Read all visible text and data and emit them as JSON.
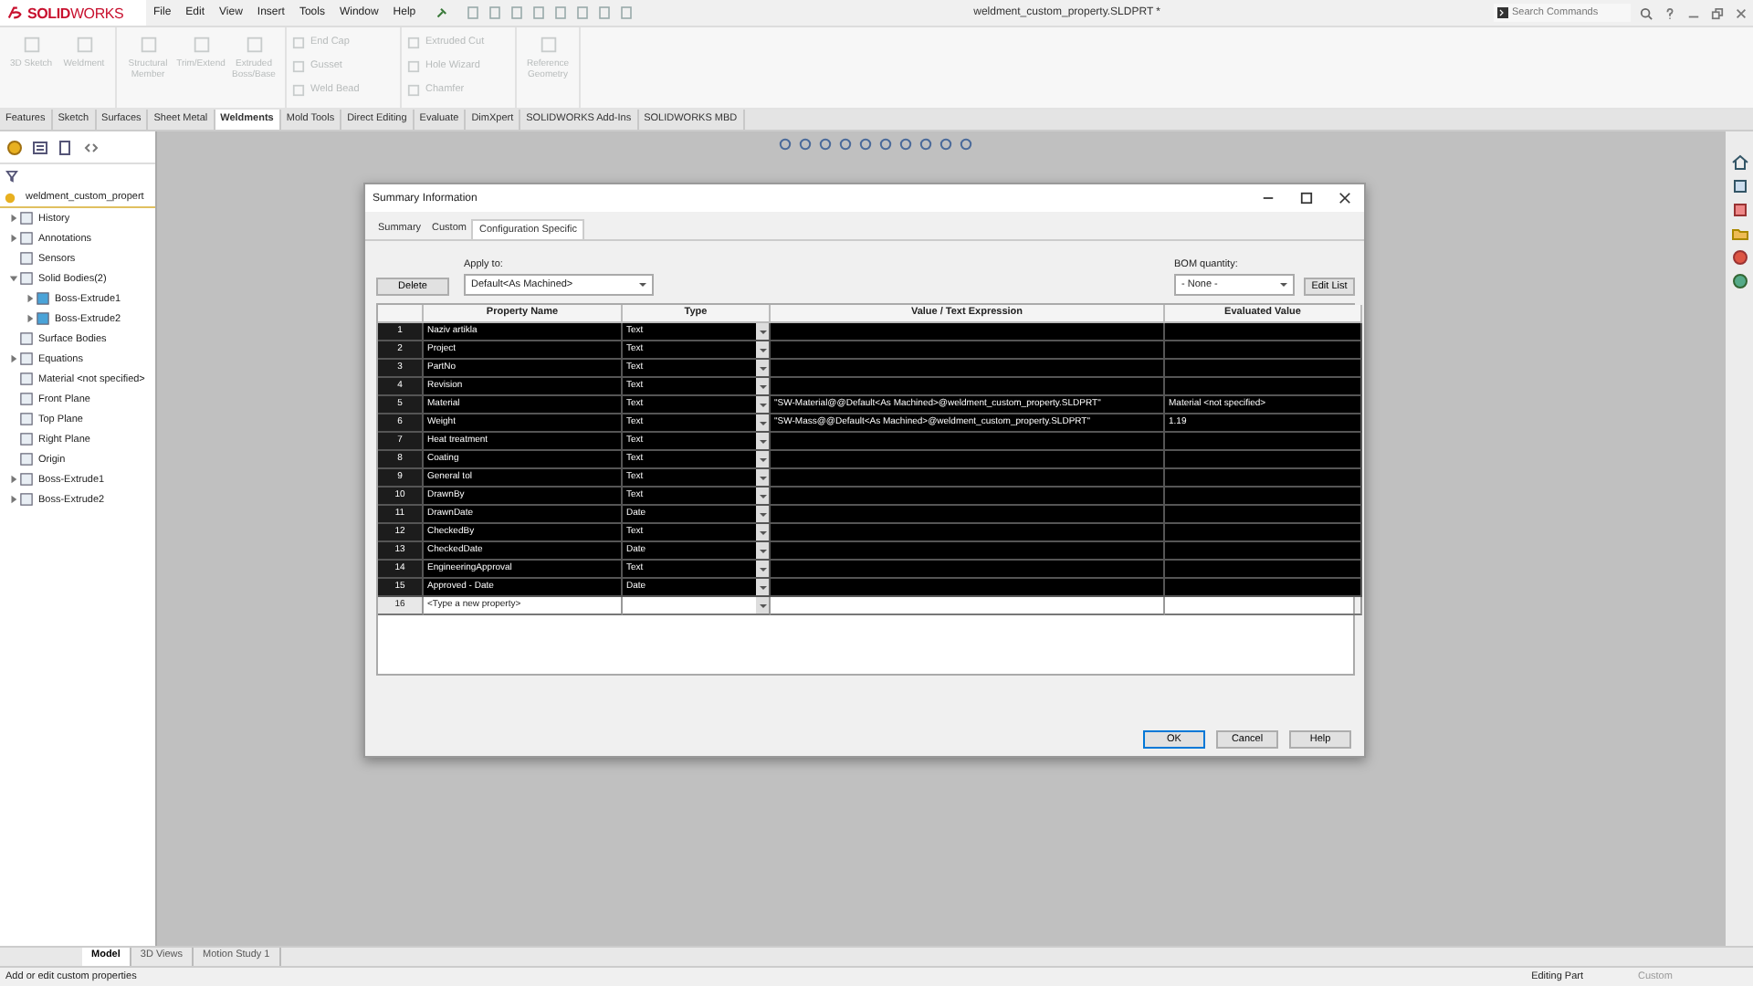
{
  "window": {
    "logo": "**SOLID**WORKS",
    "title": "weldment_custom_property.SLDPRT *"
  },
  "menu": [
    "File",
    "Edit",
    "View",
    "Insert",
    "Tools",
    "Window",
    "Help"
  ],
  "search": {
    "placeholder": "Search Commands"
  },
  "ribbon": [
    {
      "commands": [
        {
          "label": "3D Sketch",
          "kind": "large",
          "disabled": true
        },
        {
          "label": "Weldment",
          "kind": "large",
          "disabled": true
        }
      ]
    },
    {
      "commands": [
        {
          "label": "Structural Member",
          "kind": "large",
          "disabled": true
        },
        {
          "label": "Trim/Extend",
          "kind": "large",
          "disabled": true
        },
        {
          "label": "Extruded Boss/Base",
          "kind": "large",
          "disabled": true
        }
      ]
    },
    {
      "commands": [
        {
          "label": "End Cap",
          "kind": "small",
          "disabled": true
        },
        {
          "label": "Gusset",
          "kind": "small",
          "disabled": true
        },
        {
          "label": "Weld Bead",
          "kind": "small",
          "disabled": true
        }
      ]
    },
    {
      "commands": [
        {
          "label": "Extruded Cut",
          "kind": "small",
          "disabled": true
        },
        {
          "label": "Hole Wizard",
          "kind": "small",
          "disabled": true
        },
        {
          "label": "Chamfer",
          "kind": "small",
          "disabled": true
        }
      ]
    },
    {
      "commands": [
        {
          "label": "Reference Geometry",
          "kind": "large",
          "disabled": true
        }
      ]
    }
  ],
  "command_tabs": [
    {
      "label": "Features",
      "selected": false
    },
    {
      "label": "Sketch",
      "selected": false
    },
    {
      "label": "Surfaces",
      "selected": false
    },
    {
      "label": "Sheet Metal",
      "selected": false
    },
    {
      "label": "Weldments",
      "selected": true
    },
    {
      "label": "Mold Tools",
      "selected": false
    },
    {
      "label": "Direct Editing",
      "selected": false
    },
    {
      "label": "Evaluate",
      "selected": false
    },
    {
      "label": "DimXpert",
      "selected": false
    },
    {
      "label": "SOLIDWORKS Add-Ins",
      "selected": false
    },
    {
      "label": "SOLIDWORKS MBD",
      "selected": false
    }
  ],
  "feature_tree": {
    "root": "weldment_custom_propert",
    "items": [
      {
        "label": "History",
        "expanded": false
      },
      {
        "label": "Annotations",
        "expanded": false
      },
      {
        "label": "Sensors"
      },
      {
        "label": "Solid Bodies(2)",
        "expanded": true,
        "children": [
          {
            "label": "Boss-Extrude1",
            "expanded": false
          },
          {
            "label": "Boss-Extrude2",
            "expanded": false
          }
        ]
      },
      {
        "label": "Surface Bodies"
      },
      {
        "label": "Equations",
        "expanded": false
      },
      {
        "label": "Material <not specified>"
      },
      {
        "label": "Front Plane"
      },
      {
        "label": "Top Plane"
      },
      {
        "label": "Right Plane"
      },
      {
        "label": "Origin"
      },
      {
        "label": "Boss-Extrude1",
        "expanded": false
      },
      {
        "label": "Boss-Extrude2",
        "expanded": false
      }
    ]
  },
  "dialog": {
    "title": "Summary Information",
    "tabs": [
      {
        "label": "Summary",
        "selected": false
      },
      {
        "label": "Custom",
        "selected": false
      },
      {
        "label": "Configuration Specific",
        "selected": true
      }
    ],
    "delete_button": "Delete",
    "apply_to": {
      "label": "Apply to:",
      "value": "Default<As Machined>"
    },
    "bom_quantity": {
      "label": "BOM quantity:",
      "value": "- None -"
    },
    "edit_list_button": "Edit List",
    "table": {
      "columns": [
        "Property Name",
        "Type",
        "Value / Text Expression",
        "Evaluated Value"
      ],
      "rows": [
        {
          "number": "1",
          "name": "Naziv artikla",
          "type": "Text",
          "selected": true
        },
        {
          "number": "2",
          "name": "Project",
          "type": "Text",
          "selected": true
        },
        {
          "number": "3",
          "name": "PartNo",
          "type": "Text",
          "selected": true
        },
        {
          "number": "4",
          "name": "Revision",
          "type": "Text",
          "selected": true
        },
        {
          "number": "5",
          "name": "Material",
          "type": "Text",
          "value": "\"SW-Material@@Default<As Machined>@weldment_custom_property.SLDPRT\"",
          "evaluated": "Material <not specified>",
          "selected": true
        },
        {
          "number": "6",
          "name": "Weight",
          "type": "Text",
          "value": "\"SW-Mass@@Default<As Machined>@weldment_custom_property.SLDPRT\"",
          "evaluated": "1.19",
          "selected": true
        },
        {
          "number": "7",
          "name": "Heat treatment",
          "type": "Text",
          "selected": true
        },
        {
          "number": "8",
          "name": "Coating",
          "type": "Text",
          "selected": true
        },
        {
          "number": "9",
          "name": "General tol",
          "type": "Text",
          "selected": true
        },
        {
          "number": "10",
          "name": "DrawnBy",
          "type": "Text",
          "selected": true
        },
        {
          "number": "11",
          "name": "DrawnDate",
          "type": "Date",
          "selected": true
        },
        {
          "number": "12",
          "name": "CheckedBy",
          "type": "Text",
          "selected": true
        },
        {
          "number": "13",
          "name": "CheckedDate",
          "type": "Date",
          "selected": true
        },
        {
          "number": "14",
          "name": "EngineeringApproval",
          "type": "Text",
          "selected": true
        },
        {
          "number": "15",
          "name": "Approved - Date",
          "type": "Date",
          "selected": true
        },
        {
          "number": "16",
          "name": "<Type a new property>",
          "selected": false
        }
      ]
    },
    "buttons": [
      {
        "label": "OK",
        "default": true
      },
      {
        "label": "Cancel",
        "default": false
      },
      {
        "label": "Help",
        "default": false
      }
    ]
  },
  "model_tabs": [
    {
      "label": "Model",
      "selected": true
    },
    {
      "label": "3D Views",
      "selected": false
    },
    {
      "label": "Motion Study 1",
      "selected": false
    }
  ],
  "status_bar": {
    "message": "Add or edit custom properties",
    "mode": "Editing Part",
    "config": "Custom"
  }
}
